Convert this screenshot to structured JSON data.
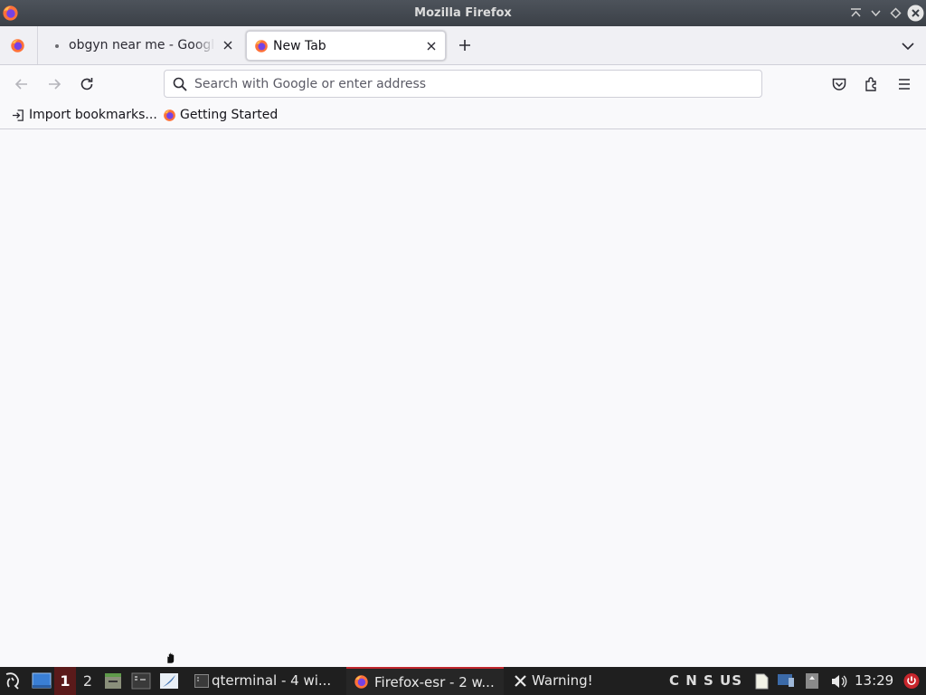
{
  "window": {
    "title": "Mozilla Firefox"
  },
  "tabs": [
    {
      "title": "obgyn near me - Google Search",
      "active": false
    },
    {
      "title": "New Tab",
      "active": true
    }
  ],
  "urlbar": {
    "placeholder": "Search with Google or enter address",
    "value": ""
  },
  "bookmarks": [
    {
      "label": "Import bookmarks...",
      "icon": "import-icon"
    },
    {
      "label": "Getting Started",
      "icon": "firefox-icon"
    }
  ],
  "taskbar": {
    "workspaces": [
      "1",
      "2"
    ],
    "active_workspace": "1",
    "tasks": [
      {
        "label": "qterminal - 4 wi...",
        "icon": "terminal-icon"
      },
      {
        "label": "Firefox-esr - 2 w...",
        "icon": "firefox-icon",
        "active": true
      },
      {
        "label": "Warning!",
        "icon": "close-x-icon"
      }
    ],
    "keyboard_indicators": "C N S US",
    "clock": "13:29"
  },
  "colors": {
    "titlebar": "#3b4047",
    "tabstrip": "#f0f0f4",
    "toolbar": "#f9f9fb",
    "taskbar": "#1f1f1f",
    "active_task_accent": "#c0262c",
    "workspace_active": "#5a1a1a"
  }
}
